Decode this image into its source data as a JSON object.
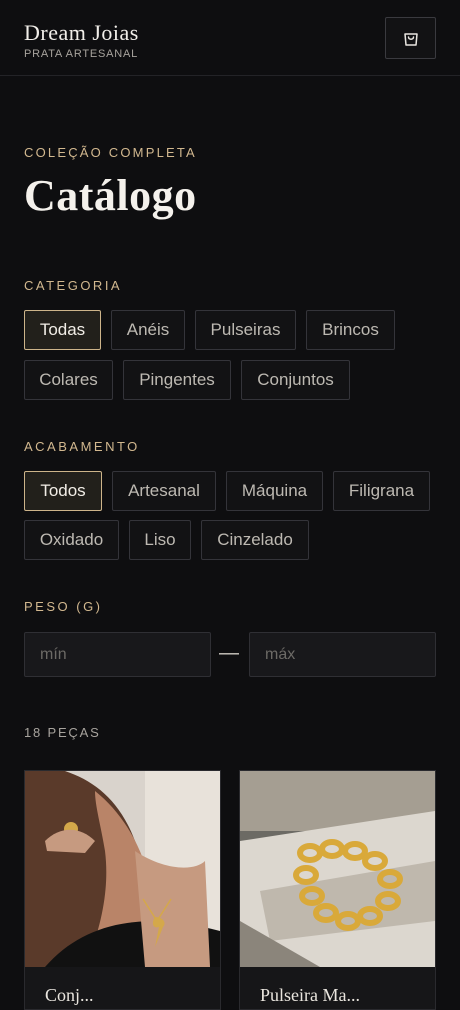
{
  "header": {
    "brand_name": "Dream Joias",
    "brand_sub": "PRATA ARTESANAL",
    "cart_icon": "shopping-bag-icon"
  },
  "hero": {
    "eyebrow": "COLEÇÃO COMPLETA",
    "title": "Catálogo"
  },
  "filters": {
    "category_label": "CATEGORIA",
    "categories": [
      "Todas",
      "Anéis",
      "Pulseiras",
      "Brincos",
      "Colares",
      "Pingentes",
      "Conjuntos"
    ],
    "finish_label": "ACABAMENTO",
    "finishes": [
      "Todos",
      "Artesanal",
      "Máquina",
      "Filigrana",
      "Oxidado",
      "Liso",
      "Cinzelado"
    ],
    "weight_label": "PESO (G)",
    "weight_min_placeholder": "mín",
    "weight_max_placeholder": "máx",
    "weight_separator": "—"
  },
  "results": {
    "count_label": "18 PEÇAS",
    "products": [
      {
        "title": "Conj..."
      },
      {
        "title": "Pulseira Ma..."
      }
    ]
  },
  "colors": {
    "background": "#0e0e10",
    "accent": "#d2b88f",
    "chip_active_border": "#cdb48a"
  }
}
